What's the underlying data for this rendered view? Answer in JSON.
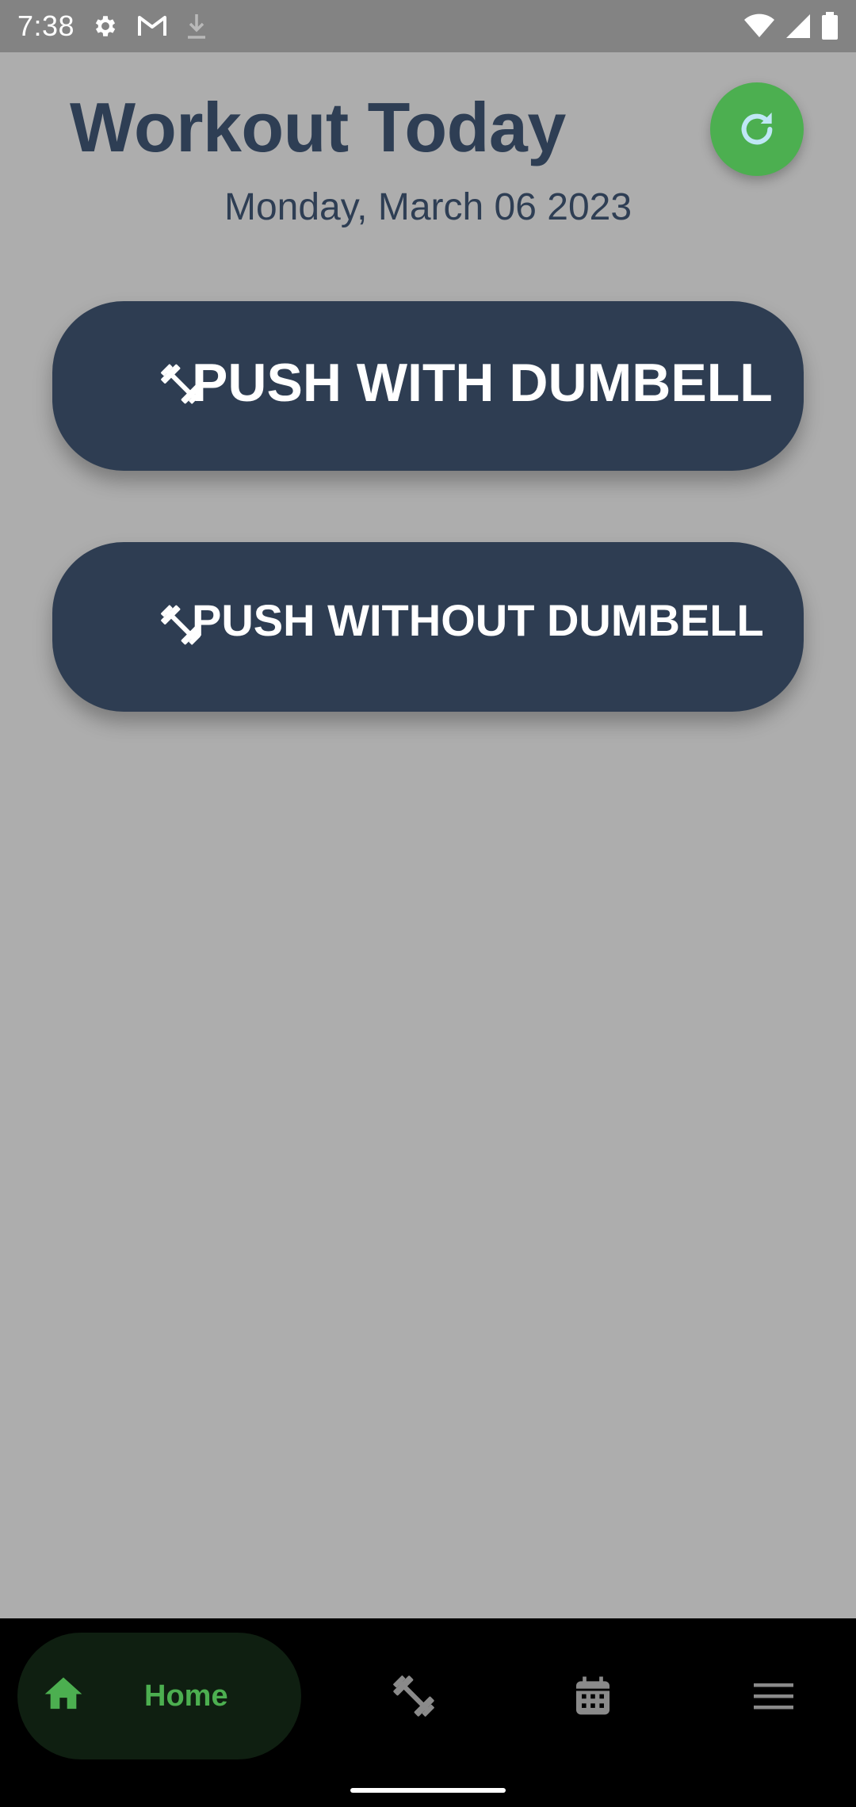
{
  "status_bar": {
    "time": "7:38",
    "icons": [
      "settings-icon",
      "gmail-icon",
      "download-icon",
      "wifi-icon",
      "cell-signal-icon",
      "battery-icon"
    ]
  },
  "header": {
    "title": "Workout Today",
    "date": "Monday, March 06 2023",
    "refresh_icon": "refresh-icon"
  },
  "workouts": [
    {
      "label": "PUSH WITH DUMBELL",
      "icon": "dumbbell-icon"
    },
    {
      "label": "PUSH WITHOUT DUMBELL",
      "icon": "dumbbell-icon"
    }
  ],
  "bottom_nav": {
    "items": [
      {
        "label": "Home",
        "icon": "home-icon",
        "active": true
      },
      {
        "label": "",
        "icon": "dumbbell-icon",
        "active": false
      },
      {
        "label": "",
        "icon": "calendar-icon",
        "active": false
      },
      {
        "label": "",
        "icon": "menu-icon",
        "active": false
      }
    ]
  },
  "colors": {
    "background": "#adadad",
    "primary_dark": "#2e3d52",
    "accent_green": "#4caf50",
    "status_bar": "#838383",
    "nav_background": "#000000",
    "nav_active_pill": "#0f1f11",
    "nav_inactive_icon": "#8a8a8a"
  }
}
